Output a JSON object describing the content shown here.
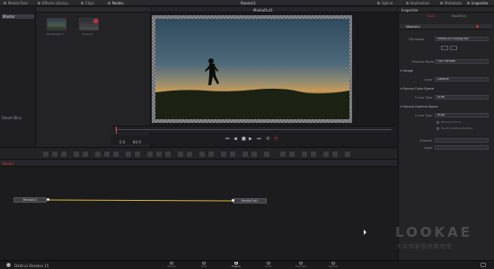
{
  "topbar": {
    "media_pool": "Media Pool",
    "effects_library": "Effects Library",
    "clips": "Clips",
    "nodes": "Nodes",
    "title": "Rossier1",
    "spline": "Spline",
    "keyframes": "Keyframes",
    "metadata": "Metadata",
    "inspector": "Inspector"
  },
  "media": {
    "header": "Master",
    "bins": [
      "Master",
      "Smart Bins"
    ],
    "clips": [
      {
        "label": "Pexels-Karl h"
      },
      {
        "label": "Fusion1"
      }
    ]
  },
  "viewer": {
    "title": "MediaOut1",
    "timecode_start": "0.0",
    "timecode_end": "84.0"
  },
  "nodes_panel": {
    "title": "Nodes",
    "node_in": "MediaIn1",
    "node_out": "MediaOut1"
  },
  "inspector": {
    "tabs": [
      "Tools",
      "Modifiers"
    ],
    "node_name": "MediaIn1",
    "file_name_label": "File Name",
    "file_name": "Pexels-KV-fullpg.mp",
    "process_mode_label": "Process Mode",
    "process_mode": "Full Frames",
    "image_section": "Image",
    "layer_label": "Layer",
    "layer": "Default",
    "source_color_space": "Source Color Space",
    "curve_type_label": "Curve Type",
    "curve_type": "Auto",
    "source_gamma_space": "Source Gamma Space",
    "curve_type_label_2": "Curve Type",
    "curve_type_2": "Auto",
    "remove_curve": "Remove Curve",
    "pre_divide": "Pre-Divide/Post-Multiply",
    "channel_label": "Channel",
    "layer_label_2": "Layer"
  },
  "pagebar": {
    "app_name": "DaVinci Resolve 15",
    "pages": [
      "Media",
      "Edit",
      "Fusion",
      "Color",
      "Fairlight",
      "Deliver"
    ],
    "active_page": "Fusion"
  },
  "watermark": {
    "text": "LOOKAE",
    "sub": "大众脸影视后期特效"
  },
  "colors": {
    "accent_red": "#c8313a",
    "link_yellow": "#d6b73a",
    "panel": "#232326"
  }
}
